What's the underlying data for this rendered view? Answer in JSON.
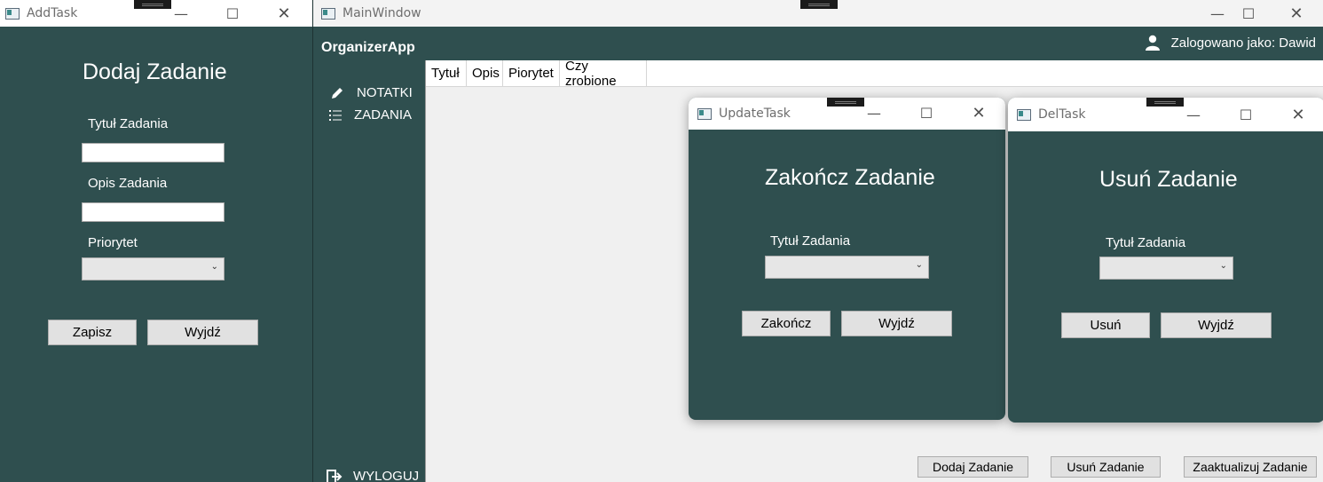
{
  "add_task": {
    "window_title": "AddTask",
    "heading": "Dodaj Zadanie",
    "title_label": "Tytuł Zadania",
    "title_value": "",
    "desc_label": "Opis Zadania",
    "desc_value": "",
    "priority_label": "Priorytet",
    "priority_value": "",
    "save_button": "Zapisz",
    "exit_button": "Wyjdź"
  },
  "main_window": {
    "window_title": "MainWindow",
    "app_name": "OrganizerApp",
    "user_label": "Zalogowano jako: Dawid",
    "nav": {
      "notes": "NOTATKI",
      "tasks": "ZADANIA",
      "logout": "WYLOGUJ"
    },
    "columns": [
      "Tytuł",
      "Opis",
      "Piorytet",
      "Czy zrobione"
    ],
    "buttons": {
      "add": "Dodaj Zadanie",
      "delete": "Usuń Zadanie",
      "update": "Zaaktualizuj Zadanie"
    }
  },
  "update_task": {
    "window_title": "UpdateTask",
    "heading": "Zakończ Zadanie",
    "title_label": "Tytuł Zadania",
    "title_value": "",
    "finish_button": "Zakończ",
    "exit_button": "Wyjdź"
  },
  "del_task": {
    "window_title": "DelTask",
    "heading": "Usuń Zadanie",
    "title_label": "Tytuł Zadania",
    "title_value": "",
    "delete_button": "Usuń",
    "exit_button": "Wyjdź"
  },
  "icons": {
    "minimize": "minimize-icon",
    "maximize": "maximize-icon",
    "close": "close-icon",
    "user": "user-icon",
    "pencil": "pencil-icon",
    "list": "list-icon",
    "logout": "logout-icon"
  },
  "colors": {
    "teal": "#2f4f4f",
    "button": "#e1e1e1"
  }
}
